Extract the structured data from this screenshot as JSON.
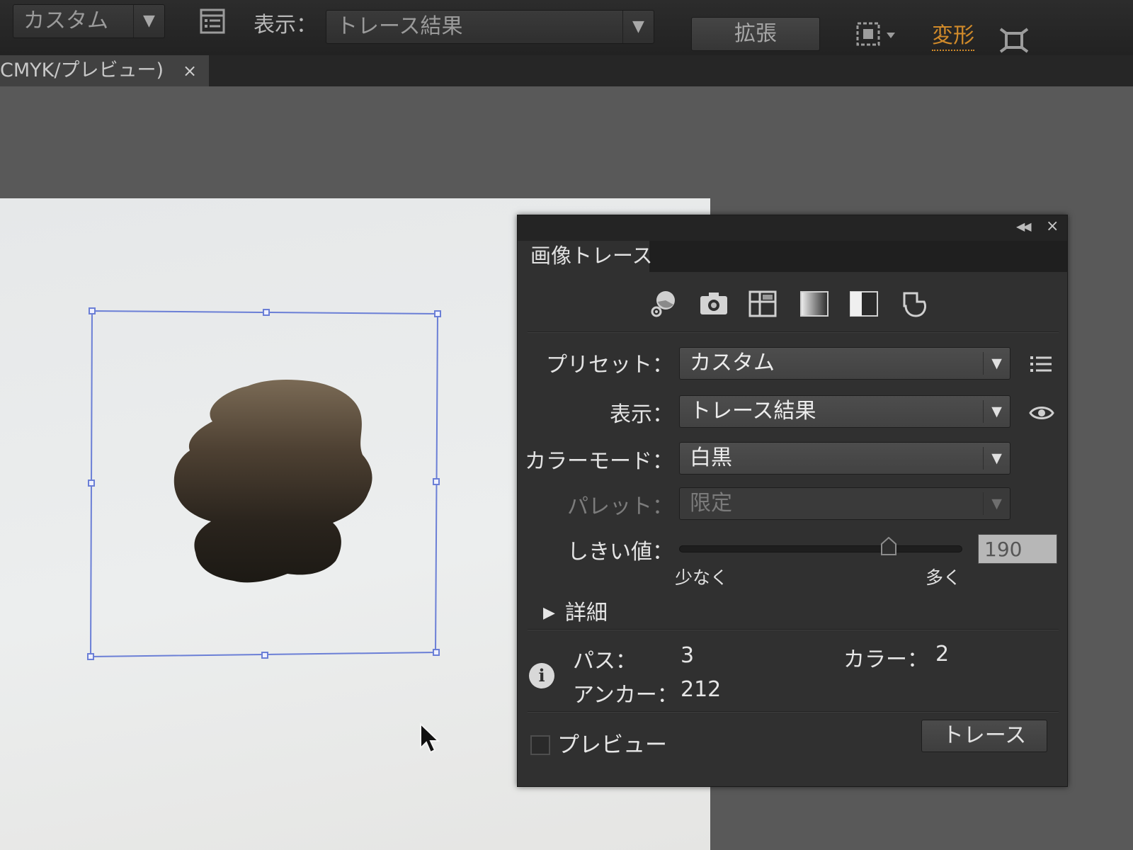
{
  "control_bar": {
    "workspace_label": "カスタム",
    "view_label": "表示：",
    "view_value": "トレース結果",
    "expand_button": "拡張",
    "transform_link": "変形"
  },
  "document_tab": {
    "title": "CMYK/プレビュー)",
    "close_glyph": "×"
  },
  "panel": {
    "title": "画像トレース",
    "preset_label": "プリセット：",
    "preset_value": "カスタム",
    "view_label": "表示：",
    "view_value": "トレース結果",
    "color_mode_label": "カラーモード：",
    "color_mode_value": "白黒",
    "palette_label": "パレット：",
    "palette_value": "限定",
    "threshold_label": "しきい値：",
    "threshold_value": "190",
    "threshold_level": 0.74,
    "slider_min_label": "少なく",
    "slider_max_label": "多く",
    "advanced_label": "詳細",
    "stats": {
      "paths_label": "パス：",
      "paths_value": "3",
      "colors_label": "カラー：",
      "colors_value": "2",
      "anchors_label": "アンカー：",
      "anchors_value": "212"
    },
    "preview_label": "プレビュー",
    "preview_checked": false,
    "trace_button": "トレース"
  },
  "icons": {
    "preset_icons": [
      "auto-color-icon",
      "high-fidelity-photo-icon",
      "low-fidelity-photo-icon",
      "grayscale-icon",
      "black-and-white-icon",
      "outline-icon"
    ],
    "presets_menu": "list-menu-icon",
    "view_toggle": "eye-icon",
    "info": "info-icon"
  }
}
